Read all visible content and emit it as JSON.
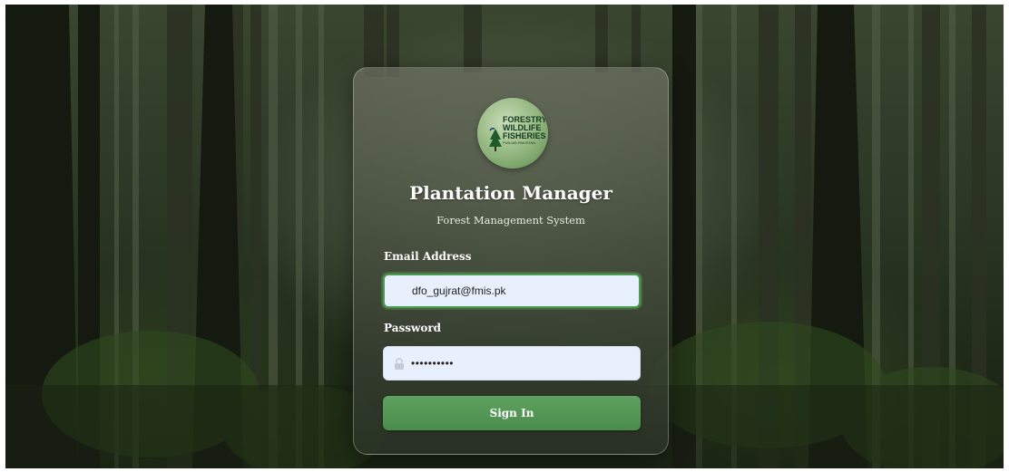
{
  "app": {
    "title": "Plantation Manager",
    "subtitle": "Forest Management System"
  },
  "logo": {
    "line1": "FORESTRY",
    "line2": "WILDLIFE",
    "line3": "FISHERIES",
    "line4": "PUNJAB PAKISTAN"
  },
  "form": {
    "email_label": "Email Address",
    "email_value": "dfo_gujrat@fmis.pk",
    "password_label": "Password",
    "password_value": "••••••••••",
    "signin_label": "Sign In"
  },
  "colors": {
    "accent": "#4f9a52",
    "field_bg": "#e8f0fe"
  }
}
